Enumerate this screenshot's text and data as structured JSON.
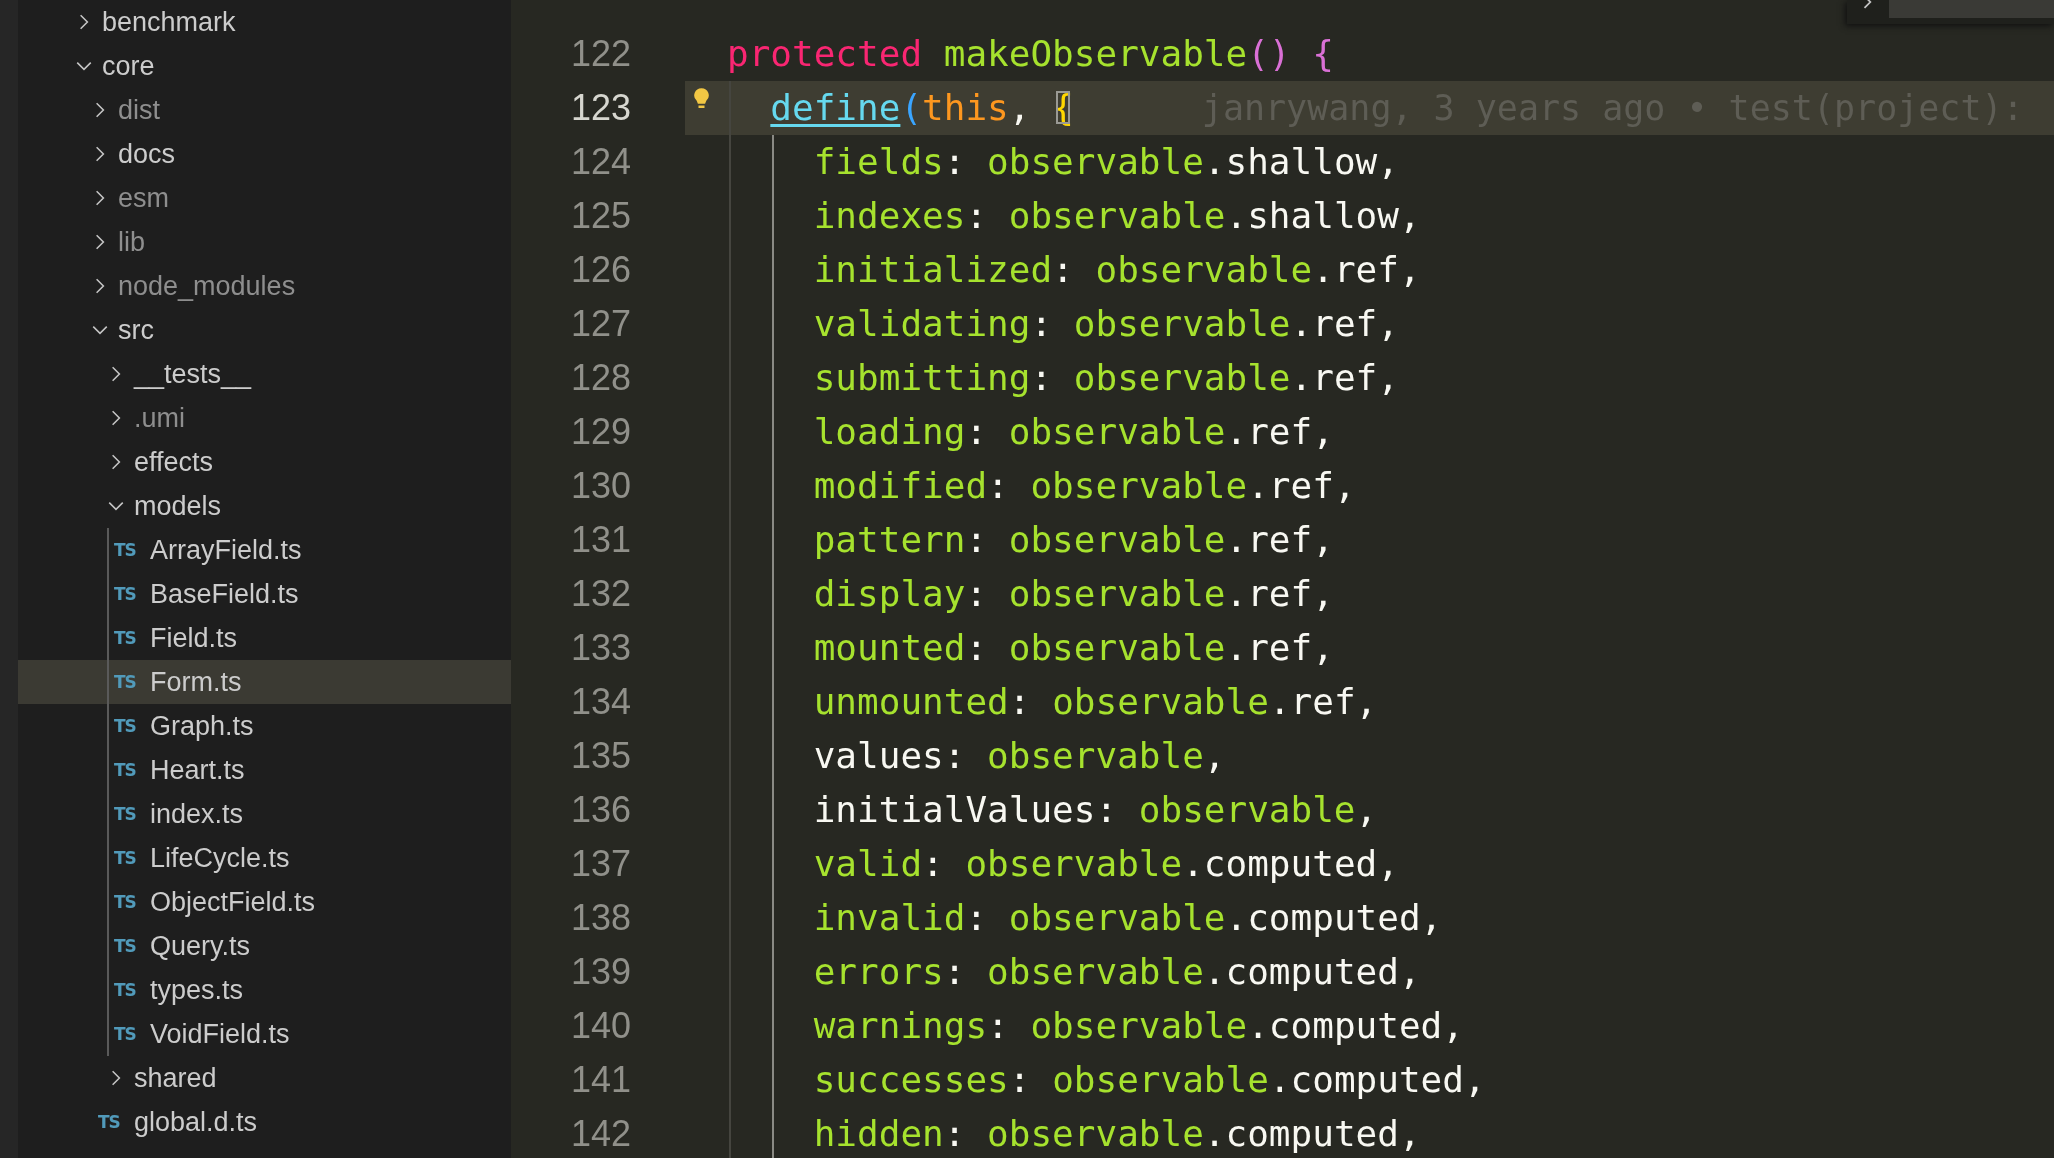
{
  "explorer": {
    "items": [
      {
        "label": "benchmark",
        "kind": "folder",
        "expanded": false,
        "dimmed": false,
        "selected": false
      },
      {
        "label": "core",
        "kind": "folder",
        "expanded": true,
        "dimmed": false,
        "selected": false,
        "children": [
          {
            "label": "dist",
            "kind": "folder",
            "expanded": false,
            "dimmed": true,
            "selected": false
          },
          {
            "label": "docs",
            "kind": "folder",
            "expanded": false,
            "dimmed": false,
            "selected": false
          },
          {
            "label": "esm",
            "kind": "folder",
            "expanded": false,
            "dimmed": true,
            "selected": false
          },
          {
            "label": "lib",
            "kind": "folder",
            "expanded": false,
            "dimmed": true,
            "selected": false
          },
          {
            "label": "node_modules",
            "kind": "folder",
            "expanded": false,
            "dimmed": true,
            "selected": false
          },
          {
            "label": "src",
            "kind": "folder",
            "expanded": true,
            "dimmed": false,
            "selected": false,
            "children": [
              {
                "label": "__tests__",
                "kind": "folder",
                "expanded": false,
                "dimmed": false,
                "selected": false
              },
              {
                "label": ".umi",
                "kind": "folder",
                "expanded": false,
                "dimmed": true,
                "selected": false
              },
              {
                "label": "effects",
                "kind": "folder",
                "expanded": false,
                "dimmed": false,
                "selected": false
              },
              {
                "label": "models",
                "kind": "folder",
                "expanded": true,
                "dimmed": false,
                "selected": false,
                "children": [
                  {
                    "label": "ArrayField.ts",
                    "kind": "file",
                    "badge": "TS",
                    "dimmed": false,
                    "selected": false
                  },
                  {
                    "label": "BaseField.ts",
                    "kind": "file",
                    "badge": "TS",
                    "dimmed": false,
                    "selected": false
                  },
                  {
                    "label": "Field.ts",
                    "kind": "file",
                    "badge": "TS",
                    "dimmed": false,
                    "selected": false
                  },
                  {
                    "label": "Form.ts",
                    "kind": "file",
                    "badge": "TS",
                    "dimmed": false,
                    "selected": true
                  },
                  {
                    "label": "Graph.ts",
                    "kind": "file",
                    "badge": "TS",
                    "dimmed": false,
                    "selected": false
                  },
                  {
                    "label": "Heart.ts",
                    "kind": "file",
                    "badge": "TS",
                    "dimmed": false,
                    "selected": false
                  },
                  {
                    "label": "index.ts",
                    "kind": "file",
                    "badge": "TS",
                    "dimmed": false,
                    "selected": false
                  },
                  {
                    "label": "LifeCycle.ts",
                    "kind": "file",
                    "badge": "TS",
                    "dimmed": false,
                    "selected": false
                  },
                  {
                    "label": "ObjectField.ts",
                    "kind": "file",
                    "badge": "TS",
                    "dimmed": false,
                    "selected": false
                  },
                  {
                    "label": "Query.ts",
                    "kind": "file",
                    "badge": "TS",
                    "dimmed": false,
                    "selected": false
                  },
                  {
                    "label": "types.ts",
                    "kind": "file",
                    "badge": "TS",
                    "dimmed": false,
                    "selected": false
                  },
                  {
                    "label": "VoidField.ts",
                    "kind": "file",
                    "badge": "TS",
                    "dimmed": false,
                    "selected": false
                  }
                ]
              },
              {
                "label": "shared",
                "kind": "folder",
                "expanded": false,
                "dimmed": false,
                "selected": false
              },
              {
                "label": "global.d.ts",
                "kind": "file",
                "badge": "TS",
                "dimmed": false,
                "selected": false
              }
            ]
          }
        ]
      }
    ]
  },
  "editor": {
    "lines": [
      {
        "number": "122",
        "active": false,
        "tokens": [
          {
            "text": "protected ",
            "kind": "keyword"
          },
          {
            "text": "makeObservable",
            "kind": "function"
          },
          {
            "text": "() {",
            "kind": "bracket-magenta"
          }
        ],
        "children": [
          {
            "number": "123",
            "active": true,
            "blame": "janrywang, 3 years ago • test(project):",
            "tokens": [
              {
                "text": "define",
                "kind": "link"
              },
              {
                "text": "(",
                "kind": "bracket-blue"
              },
              {
                "text": "this",
                "kind": "this"
              },
              {
                "text": ", ",
                "kind": "plain"
              },
              {
                "text": "{",
                "kind": "bracket-match"
              }
            ],
            "children": [
              {
                "number": "124",
                "active": false,
                "tokens": [
                  {
                    "text": "fields",
                    "kind": "property"
                  },
                  {
                    "text": ": ",
                    "kind": "plain"
                  },
                  {
                    "text": "observable",
                    "kind": "identifier"
                  },
                  {
                    "text": ".shallow,",
                    "kind": "plain"
                  }
                ]
              },
              {
                "number": "125",
                "active": false,
                "tokens": [
                  {
                    "text": "indexes",
                    "kind": "property"
                  },
                  {
                    "text": ": ",
                    "kind": "plain"
                  },
                  {
                    "text": "observable",
                    "kind": "identifier"
                  },
                  {
                    "text": ".shallow,",
                    "kind": "plain"
                  }
                ]
              },
              {
                "number": "126",
                "active": false,
                "tokens": [
                  {
                    "text": "initialized",
                    "kind": "property"
                  },
                  {
                    "text": ": ",
                    "kind": "plain"
                  },
                  {
                    "text": "observable",
                    "kind": "identifier"
                  },
                  {
                    "text": ".ref,",
                    "kind": "plain"
                  }
                ]
              },
              {
                "number": "127",
                "active": false,
                "tokens": [
                  {
                    "text": "validating",
                    "kind": "property"
                  },
                  {
                    "text": ": ",
                    "kind": "plain"
                  },
                  {
                    "text": "observable",
                    "kind": "identifier"
                  },
                  {
                    "text": ".ref,",
                    "kind": "plain"
                  }
                ]
              },
              {
                "number": "128",
                "active": false,
                "tokens": [
                  {
                    "text": "submitting",
                    "kind": "property"
                  },
                  {
                    "text": ": ",
                    "kind": "plain"
                  },
                  {
                    "text": "observable",
                    "kind": "identifier"
                  },
                  {
                    "text": ".ref,",
                    "kind": "plain"
                  }
                ]
              },
              {
                "number": "129",
                "active": false,
                "tokens": [
                  {
                    "text": "loading",
                    "kind": "property"
                  },
                  {
                    "text": ": ",
                    "kind": "plain"
                  },
                  {
                    "text": "observable",
                    "kind": "identifier"
                  },
                  {
                    "text": ".ref,",
                    "kind": "plain"
                  }
                ]
              },
              {
                "number": "130",
                "active": false,
                "tokens": [
                  {
                    "text": "modified",
                    "kind": "property"
                  },
                  {
                    "text": ": ",
                    "kind": "plain"
                  },
                  {
                    "text": "observable",
                    "kind": "identifier"
                  },
                  {
                    "text": ".ref,",
                    "kind": "plain"
                  }
                ]
              },
              {
                "number": "131",
                "active": false,
                "tokens": [
                  {
                    "text": "pattern",
                    "kind": "property"
                  },
                  {
                    "text": ": ",
                    "kind": "plain"
                  },
                  {
                    "text": "observable",
                    "kind": "identifier"
                  },
                  {
                    "text": ".ref,",
                    "kind": "plain"
                  }
                ]
              },
              {
                "number": "132",
                "active": false,
                "tokens": [
                  {
                    "text": "display",
                    "kind": "property"
                  },
                  {
                    "text": ": ",
                    "kind": "plain"
                  },
                  {
                    "text": "observable",
                    "kind": "identifier"
                  },
                  {
                    "text": ".ref,",
                    "kind": "plain"
                  }
                ]
              },
              {
                "number": "133",
                "active": false,
                "tokens": [
                  {
                    "text": "mounted",
                    "kind": "property"
                  },
                  {
                    "text": ": ",
                    "kind": "plain"
                  },
                  {
                    "text": "observable",
                    "kind": "identifier"
                  },
                  {
                    "text": ".ref,",
                    "kind": "plain"
                  }
                ]
              },
              {
                "number": "134",
                "active": false,
                "tokens": [
                  {
                    "text": "unmounted",
                    "kind": "property"
                  },
                  {
                    "text": ": ",
                    "kind": "plain"
                  },
                  {
                    "text": "observable",
                    "kind": "identifier"
                  },
                  {
                    "text": ".ref,",
                    "kind": "plain"
                  }
                ]
              },
              {
                "number": "135",
                "active": false,
                "tokens": [
                  {
                    "text": "values: ",
                    "kind": "plain"
                  },
                  {
                    "text": "observable",
                    "kind": "identifier"
                  },
                  {
                    "text": ",",
                    "kind": "plain"
                  }
                ]
              },
              {
                "number": "136",
                "active": false,
                "tokens": [
                  {
                    "text": "initialValues: ",
                    "kind": "plain"
                  },
                  {
                    "text": "observable",
                    "kind": "identifier"
                  },
                  {
                    "text": ",",
                    "kind": "plain"
                  }
                ]
              },
              {
                "number": "137",
                "active": false,
                "tokens": [
                  {
                    "text": "valid",
                    "kind": "property"
                  },
                  {
                    "text": ": ",
                    "kind": "plain"
                  },
                  {
                    "text": "observable",
                    "kind": "identifier"
                  },
                  {
                    "text": ".computed,",
                    "kind": "plain"
                  }
                ]
              },
              {
                "number": "138",
                "active": false,
                "tokens": [
                  {
                    "text": "invalid",
                    "kind": "property"
                  },
                  {
                    "text": ": ",
                    "kind": "plain"
                  },
                  {
                    "text": "observable",
                    "kind": "identifier"
                  },
                  {
                    "text": ".computed,",
                    "kind": "plain"
                  }
                ]
              },
              {
                "number": "139",
                "active": false,
                "tokens": [
                  {
                    "text": "errors",
                    "kind": "property"
                  },
                  {
                    "text": ": ",
                    "kind": "plain"
                  },
                  {
                    "text": "observable",
                    "kind": "identifier"
                  },
                  {
                    "text": ".computed,",
                    "kind": "plain"
                  }
                ]
              },
              {
                "number": "140",
                "active": false,
                "tokens": [
                  {
                    "text": "warnings",
                    "kind": "property"
                  },
                  {
                    "text": ": ",
                    "kind": "plain"
                  },
                  {
                    "text": "observable",
                    "kind": "identifier"
                  },
                  {
                    "text": ".computed,",
                    "kind": "plain"
                  }
                ]
              },
              {
                "number": "141",
                "active": false,
                "tokens": [
                  {
                    "text": "successes",
                    "kind": "property"
                  },
                  {
                    "text": ": ",
                    "kind": "plain"
                  },
                  {
                    "text": "observable",
                    "kind": "identifier"
                  },
                  {
                    "text": ".computed,",
                    "kind": "plain"
                  }
                ]
              },
              {
                "number": "142",
                "active": false,
                "tokens": [
                  {
                    "text": "hidden",
                    "kind": "property"
                  },
                  {
                    "text": ": ",
                    "kind": "plain"
                  },
                  {
                    "text": "observable",
                    "kind": "identifier"
                  },
                  {
                    "text": ".computed,",
                    "kind": "plain"
                  }
                ]
              }
            ]
          }
        ]
      }
    ]
  }
}
